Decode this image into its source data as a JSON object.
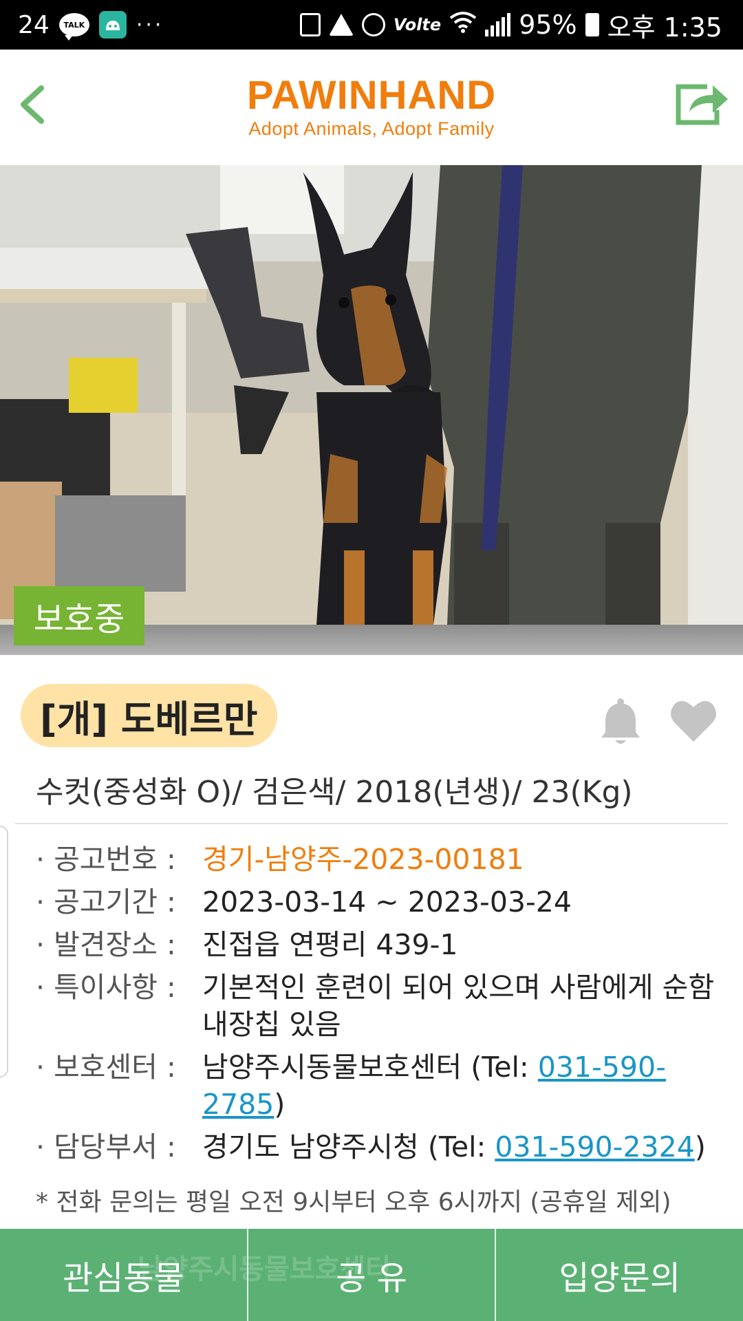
{
  "status_bar": {
    "date": "24",
    "talk_label": "TALK",
    "dots": "···",
    "volte": "Volte",
    "battery": "95%",
    "time": "오후 1:35"
  },
  "header": {
    "logo_title": "PAWINHAND",
    "logo_subtitle": "Adopt Animals, Adopt Family"
  },
  "photo": {
    "status_badge": "보호중"
  },
  "animal": {
    "species_title": "[개] 도베르만",
    "summary": "수컷(중성화 O)/ 검은색/ 2018(년생)/ 23(Kg)"
  },
  "details": [
    {
      "label": "· 공고번호 :",
      "value": "경기-남양주-2023-00181"
    },
    {
      "label": "· 공고기간 :",
      "value": "2023-03-14 ~ 2023-03-24"
    },
    {
      "label": "· 발견장소 :",
      "value": "진접읍 연평리 439-1"
    },
    {
      "label": "· 특이사항 :",
      "value": "기본적인 훈련이 되어 있으며 사람에게 순함 내장칩 있음"
    },
    {
      "label": "· 보호센터 :",
      "value_prefix": "남양주시동물보호센터 (Tel: ",
      "phone": "031-590-2785",
      "value_suffix": ")"
    },
    {
      "label": "· 담당부서 :",
      "value_prefix": "경기도 남양주시청 (Tel: ",
      "phone": "031-590-2324",
      "value_suffix": ")"
    }
  ],
  "note": "* 전화 문의는 평일 오전 9시부터 오후 6시까지 (공휴일 제외)",
  "bottom_bar": {
    "favorite": "관심동물",
    "share": "공 유",
    "adopt_inquiry": "입양문의",
    "watermark": "남양주시동물보호센터"
  },
  "colors": {
    "brand_orange": "#f07d0c",
    "badge_green": "#77b433",
    "bottom_green": "#5bb174",
    "pill_yellow": "#ffe2a6",
    "link_blue": "#1a95c8"
  }
}
